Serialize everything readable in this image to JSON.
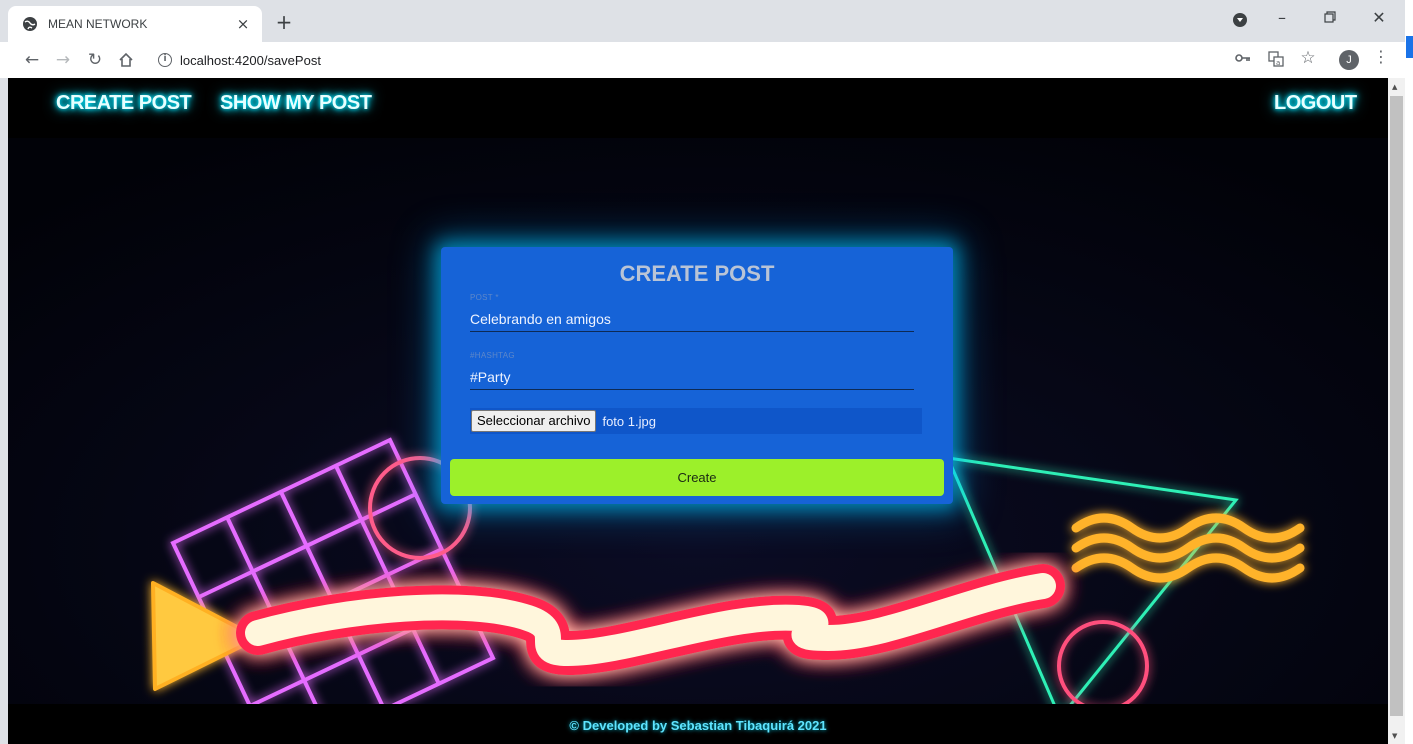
{
  "browser": {
    "tab_title": "MEAN NETWORK",
    "tab_close": "×",
    "new_tab": "+",
    "url": "localhost:4200/savePost",
    "avatar_letter": "J",
    "colors": {
      "tabbar": "#dee1e6",
      "toolbar": "#ffffff",
      "avatar": "#5f6368"
    }
  },
  "nav": {
    "create_post": "CREATE POST",
    "show_my_post": "SHOW MY POST",
    "logout": "LOGOUT"
  },
  "form": {
    "title": "CREATE POST",
    "post_label": "POST *",
    "post_value": "Celebrando en amigos",
    "hashtag_label": "#HASHTAG",
    "hashtag_value": "#Party",
    "file_button": "Seleccionar archivo",
    "file_name": "foto 1.jpg",
    "submit_label": "Create",
    "colors": {
      "card": "#1663d7",
      "submit": "#9cf02a",
      "glow": "#00c8ff"
    }
  },
  "footer": {
    "text": "© Developed by Sebastian Tibaquirá 2021"
  }
}
